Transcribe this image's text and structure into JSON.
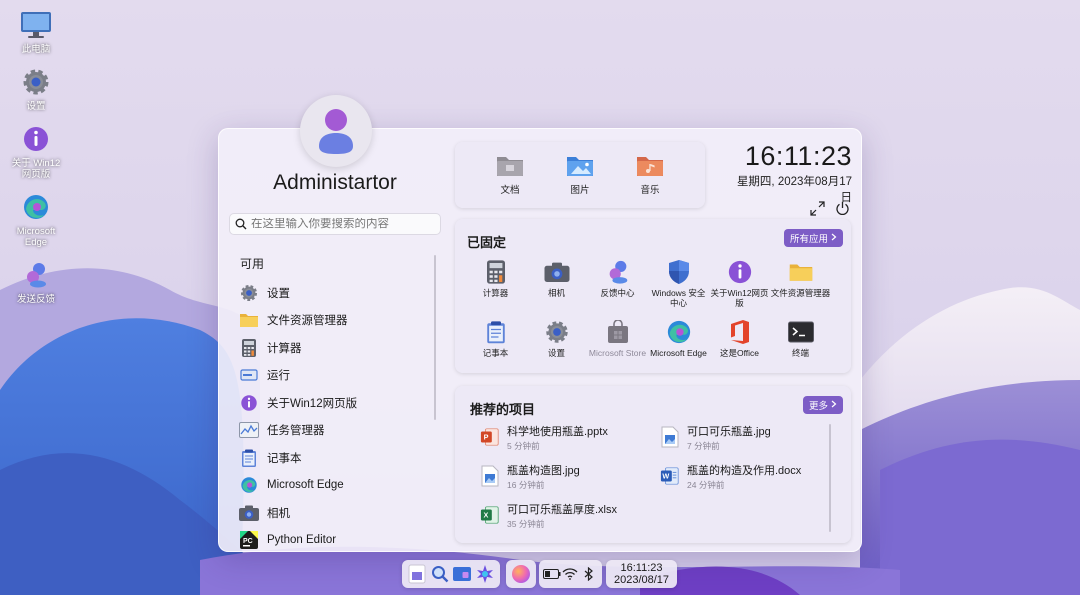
{
  "desktop": {
    "icons": [
      {
        "label": "此电脑",
        "icon": "computer-icon"
      },
      {
        "label": "设置",
        "icon": "gear-icon"
      },
      {
        "label": "关于 Win12 网页版",
        "icon": "info-icon"
      },
      {
        "label": "Microsoft Edge",
        "icon": "edge-icon"
      },
      {
        "label": "发送反馈",
        "icon": "feedback-icon"
      }
    ]
  },
  "start": {
    "username": "Administartor",
    "search_placeholder": "在这里输入你要搜索的内容",
    "available_label": "可用",
    "apps": [
      {
        "label": "设置",
        "icon": "gear-icon"
      },
      {
        "label": "文件资源管理器",
        "icon": "folder-icon"
      },
      {
        "label": "计算器",
        "icon": "calculator-icon"
      },
      {
        "label": "运行",
        "icon": "run-icon"
      },
      {
        "label": "关于Win12网页版",
        "icon": "info-icon"
      },
      {
        "label": "任务管理器",
        "icon": "task-manager-icon"
      },
      {
        "label": "记事本",
        "icon": "notepad-icon"
      },
      {
        "label": "Microsoft Edge",
        "icon": "edge-icon"
      },
      {
        "label": "相机",
        "icon": "camera-icon"
      },
      {
        "label": "Python Editor",
        "icon": "python-editor-icon"
      }
    ],
    "folders": [
      {
        "label": "文档",
        "icon": "documents-folder-icon"
      },
      {
        "label": "图片",
        "icon": "pictures-folder-icon"
      },
      {
        "label": "音乐",
        "icon": "music-folder-icon"
      }
    ],
    "clock": {
      "time": "16:11:23",
      "date": "星期四, 2023年08月17日"
    },
    "pinned": {
      "title": "已固定",
      "all_apps_label": "所有应用",
      "items": [
        {
          "label": "计算器",
          "icon": "calculator-icon",
          "disabled": false
        },
        {
          "label": "相机",
          "icon": "camera-icon",
          "disabled": false
        },
        {
          "label": "反馈中心",
          "icon": "feedback-icon",
          "disabled": false
        },
        {
          "label": "Windows 安全中心",
          "icon": "shield-icon",
          "disabled": false
        },
        {
          "label": "关于Win12网页版",
          "icon": "info-icon",
          "disabled": false
        },
        {
          "label": "文件资源管理器",
          "icon": "folder-icon",
          "disabled": false
        },
        {
          "label": "记事本",
          "icon": "notepad-icon",
          "disabled": false
        },
        {
          "label": "设置",
          "icon": "gear-icon",
          "disabled": false
        },
        {
          "label": "Microsoft Store",
          "icon": "store-icon",
          "disabled": true
        },
        {
          "label": "Microsoft Edge",
          "icon": "edge-icon",
          "disabled": false
        },
        {
          "label": "这是Office",
          "icon": "office-icon",
          "disabled": false
        },
        {
          "label": "终端",
          "icon": "terminal-icon",
          "disabled": false
        }
      ]
    },
    "recommended": {
      "title": "推荐的项目",
      "more_label": "更多",
      "items": [
        {
          "name": "科学地使用瓶盖.pptx",
          "time": "5 分钟前",
          "icon": "powerpoint-file-icon"
        },
        {
          "name": "可口可乐瓶盖.jpg",
          "time": "7 分钟前",
          "icon": "image-file-icon"
        },
        {
          "name": "瓶盖构造图.jpg",
          "time": "16 分钟前",
          "icon": "image-file-icon"
        },
        {
          "name": "瓶盖的构造及作用.docx",
          "time": "24 分钟前",
          "icon": "word-file-icon"
        },
        {
          "name": "可口可乐瓶盖厚度.xlsx",
          "time": "35 分钟前",
          "icon": "excel-file-icon"
        }
      ]
    }
  },
  "taskbar": {
    "time": "16:11:23",
    "date": "2023/08/17"
  }
}
